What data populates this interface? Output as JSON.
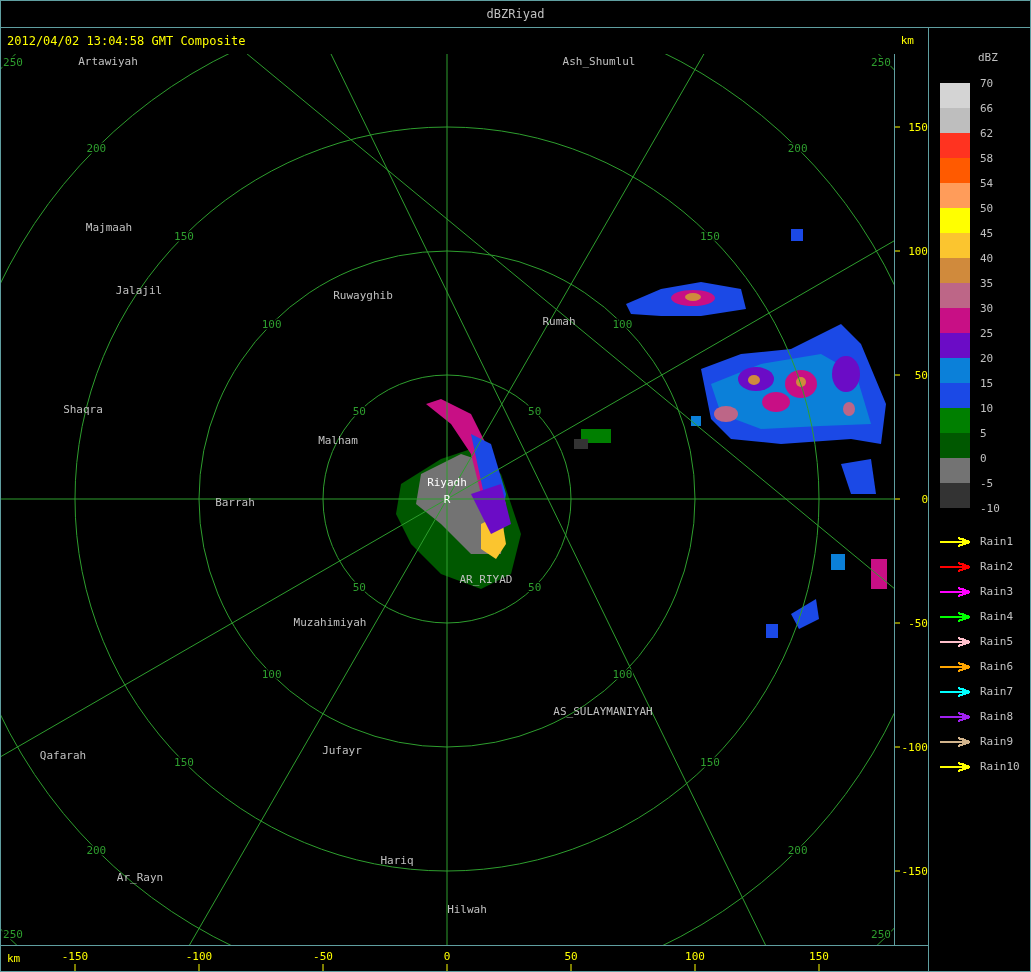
{
  "window": {
    "title": "dBZRiyad"
  },
  "header": {
    "timestamp": "2012/04/02 13:04:58 GMT Composite",
    "unit": "km"
  },
  "map": {
    "range_rings": [
      {
        "labels": [
          "50",
          "50",
          "50",
          "50"
        ]
      },
      {
        "labels": [
          "100",
          "100",
          "100",
          "100"
        ]
      },
      {
        "labels": [
          "150",
          "150",
          "150",
          "150"
        ]
      },
      {
        "labels": [
          "200",
          "200",
          "200",
          "200"
        ]
      },
      {
        "labels": [
          "250",
          "250",
          "250",
          "250"
        ]
      }
    ],
    "cities": [
      {
        "name": "Artawiyah",
        "kind": "town"
      },
      {
        "name": "Ash_Shumlul",
        "kind": "town"
      },
      {
        "name": "Majmaah",
        "kind": "town"
      },
      {
        "name": "Jalajil",
        "kind": "town"
      },
      {
        "name": "Ruwayghib",
        "kind": "town"
      },
      {
        "name": "Rumah",
        "kind": "town"
      },
      {
        "name": "Shaqra",
        "kind": "town"
      },
      {
        "name": "Malham",
        "kind": "town"
      },
      {
        "name": "Riyadh",
        "kind": "radar"
      },
      {
        "name": "Barrah",
        "kind": "town"
      },
      {
        "name": "AR_RIYAD",
        "kind": "town"
      },
      {
        "name": "Muzahimiyah",
        "kind": "town"
      },
      {
        "name": "AS_SULAYMANIYAH",
        "kind": "town"
      },
      {
        "name": "Qafarah",
        "kind": "town"
      },
      {
        "name": "Jufayr",
        "kind": "town"
      },
      {
        "name": "Hariq",
        "kind": "town"
      },
      {
        "name": "Ar_Rayn",
        "kind": "town"
      },
      {
        "name": "Hilwah",
        "kind": "town"
      }
    ],
    "site_marker": "R"
  },
  "y_axis": {
    "ticks": [
      "150",
      "100",
      "50",
      "0",
      "-50",
      "-100",
      "-150"
    ]
  },
  "x_axis": {
    "unit": "km",
    "ticks": [
      "-150",
      "-100",
      "-50",
      "0",
      "50",
      "100",
      "150"
    ]
  },
  "legend": {
    "title": "dBZ",
    "levels": [
      "70",
      "66",
      "62",
      "58",
      "54",
      "50",
      "45",
      "40",
      "35",
      "30",
      "25",
      "20",
      "15",
      "10",
      "5",
      "0",
      "-5",
      "-10"
    ],
    "bands": [
      {
        "color": "#d4d4d4"
      },
      {
        "color": "#bebebe"
      },
      {
        "color": "#ff3320"
      },
      {
        "color": "#ff5a00"
      },
      {
        "color": "#ff9c5a"
      },
      {
        "color": "#ffff00"
      },
      {
        "color": "#fbc52f"
      },
      {
        "color": "#d08a3c"
      },
      {
        "color": "#bd6687"
      },
      {
        "color": "#c80f85"
      },
      {
        "color": "#6b0cc6"
      },
      {
        "color": "#0b80d9"
      },
      {
        "color": "#1b49e6"
      },
      {
        "color": "#007f00"
      },
      {
        "color": "#005800"
      },
      {
        "color": "#737373"
      },
      {
        "color": "#333333"
      }
    ]
  },
  "tracks": [
    {
      "label": "Rain1",
      "color": "#ffff00"
    },
    {
      "label": "Rain2",
      "color": "#ff0000"
    },
    {
      "label": "Rain3",
      "color": "#ff00ff"
    },
    {
      "label": "Rain4",
      "color": "#00ff00"
    },
    {
      "label": "Rain5",
      "color": "#ffc0cb"
    },
    {
      "label": "Rain6",
      "color": "#ffa500"
    },
    {
      "label": "Rain7",
      "color": "#00ffff"
    },
    {
      "label": "Rain8",
      "color": "#a020f0"
    },
    {
      "label": "Rain9",
      "color": "#d2b48c"
    },
    {
      "label": "Rain10",
      "color": "#ffff00"
    }
  ]
}
